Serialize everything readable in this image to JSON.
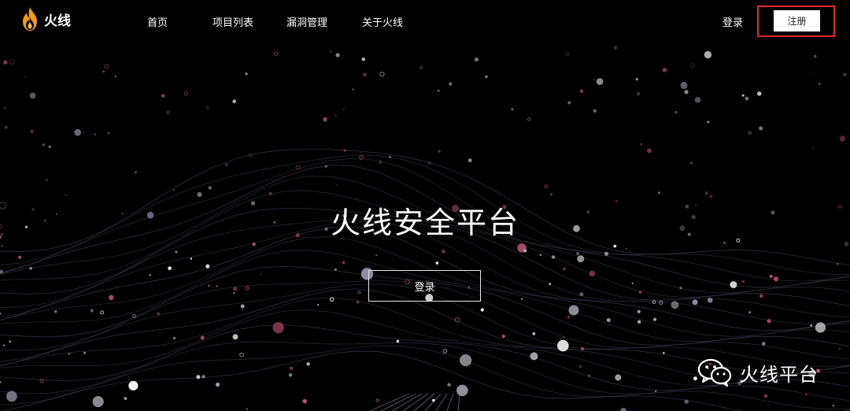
{
  "brand": {
    "name": "火线",
    "logo_icon": "flame-icon"
  },
  "nav": {
    "items": [
      {
        "label": "首页"
      },
      {
        "label": "项目列表"
      },
      {
        "label": "漏洞管理"
      },
      {
        "label": "关于火线"
      }
    ],
    "login_label": "登录",
    "register_label": "注册"
  },
  "hero": {
    "title": "火线安全平台",
    "login_button": "登录"
  },
  "watermark": {
    "icon": "wechat-icon",
    "text": "火线平台"
  },
  "colors": {
    "background": "#000000",
    "highlight_border": "#e8252a",
    "flame_orange": "#f39a1e",
    "particle_pink": "#c0607a",
    "particle_grey": "#b8b8c8"
  }
}
